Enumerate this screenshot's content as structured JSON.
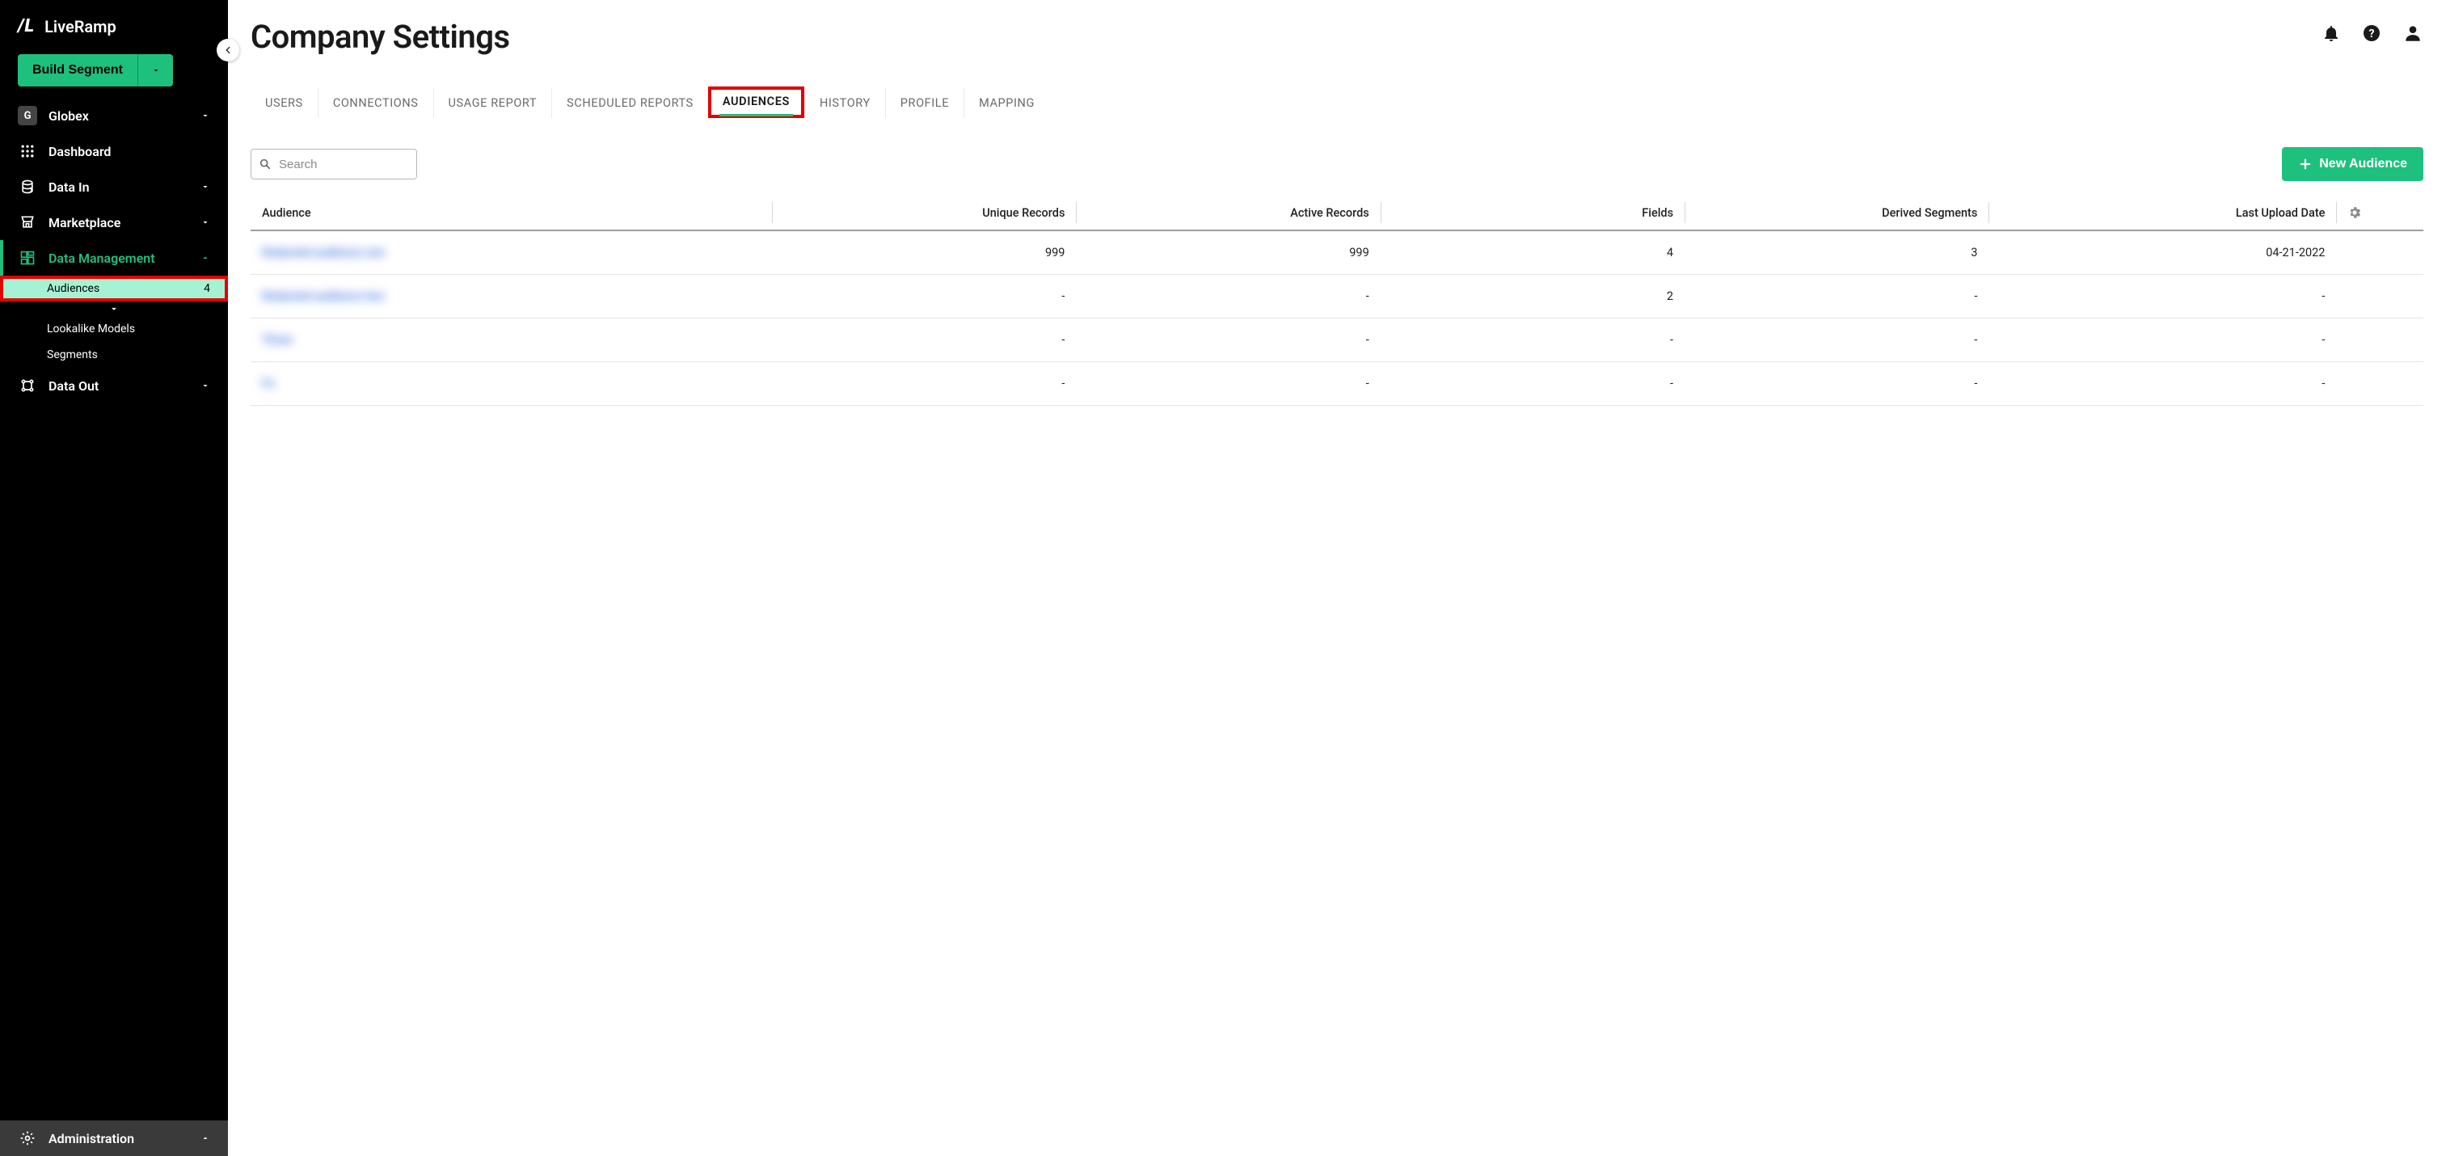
{
  "brand": {
    "logo": "/L",
    "name": "LiveRamp"
  },
  "build_segment": {
    "label": "Build Segment"
  },
  "org": {
    "initial": "G",
    "name": "Globex"
  },
  "sidebar": {
    "items": [
      {
        "label": "Dashboard"
      },
      {
        "label": "Data In"
      },
      {
        "label": "Marketplace"
      },
      {
        "label": "Data Management"
      },
      {
        "label": "Data Out"
      }
    ],
    "data_management_sub": [
      {
        "label": "Audiences",
        "count": "4"
      },
      {
        "label": "Lookalike Models"
      },
      {
        "label": "Segments"
      }
    ],
    "footer": {
      "label": "Administration"
    }
  },
  "page": {
    "title": "Company Settings"
  },
  "tabs": [
    {
      "label": "USERS"
    },
    {
      "label": "CONNECTIONS"
    },
    {
      "label": "USAGE REPORT"
    },
    {
      "label": "SCHEDULED REPORTS"
    },
    {
      "label": "AUDIENCES"
    },
    {
      "label": "HISTORY"
    },
    {
      "label": "PROFILE"
    },
    {
      "label": "MAPPING"
    }
  ],
  "search": {
    "placeholder": "Search"
  },
  "new_audience": {
    "label": "New Audience"
  },
  "table": {
    "headers": {
      "audience": "Audience",
      "unique_records": "Unique Records",
      "active_records": "Active Records",
      "fields": "Fields",
      "derived_segments": "Derived Segments",
      "last_upload": "Last Upload Date"
    },
    "rows": [
      {
        "audience": "Redacted audience one",
        "unique": "999",
        "active": "999",
        "fields": "4",
        "derived": "3",
        "last_upload": "04-21-2022"
      },
      {
        "audience": "Redacted audience two",
        "unique": "-",
        "active": "-",
        "fields": "2",
        "derived": "-",
        "last_upload": "-"
      },
      {
        "audience": "Three",
        "unique": "-",
        "active": "-",
        "fields": "-",
        "derived": "-",
        "last_upload": "-"
      },
      {
        "audience": "Fo",
        "unique": "-",
        "active": "-",
        "fields": "-",
        "derived": "-",
        "last_upload": "-"
      }
    ]
  }
}
